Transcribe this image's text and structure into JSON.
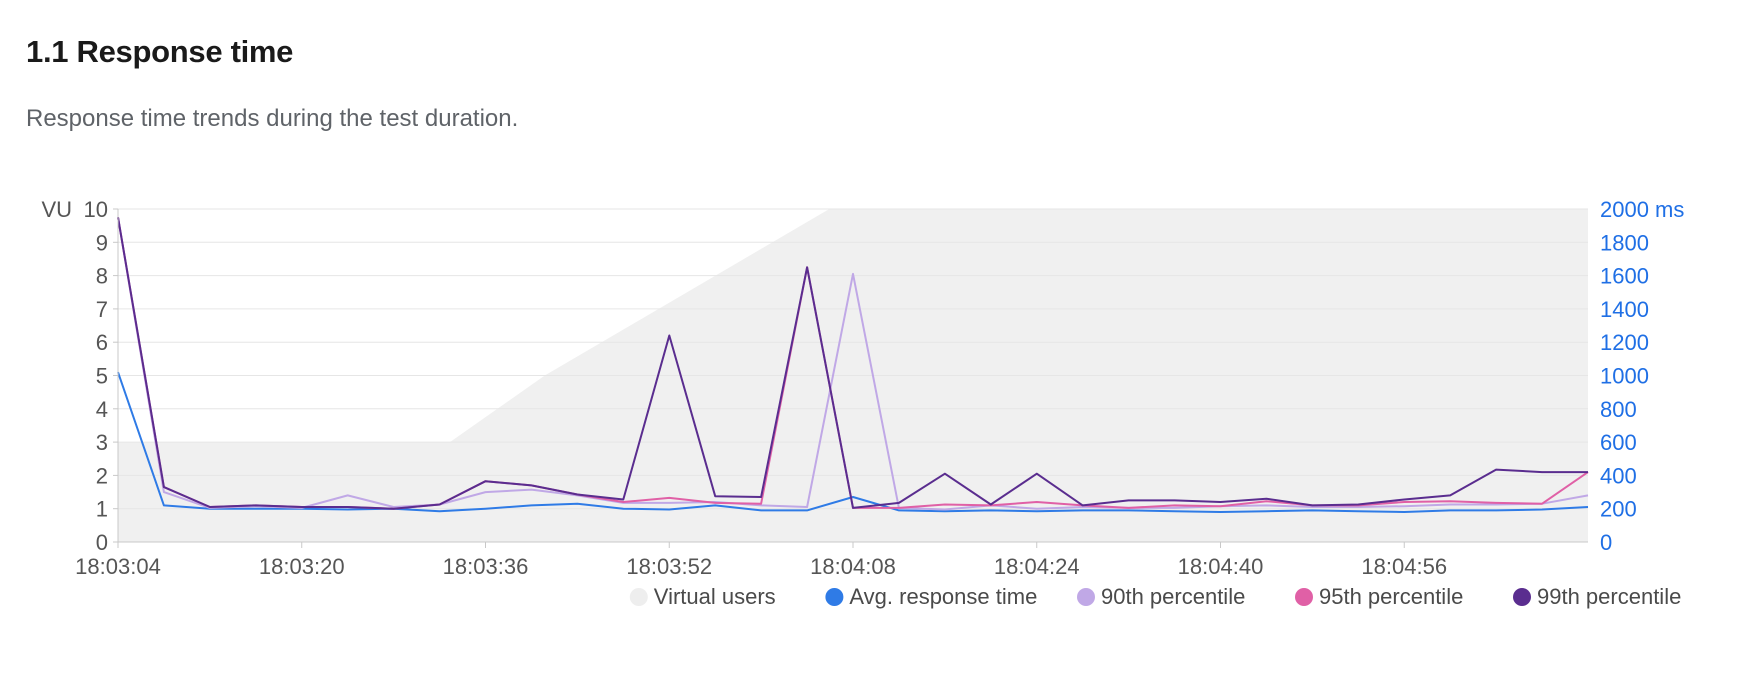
{
  "section": {
    "title": "1.1 Response time",
    "description": "Response time trends during the test duration."
  },
  "chart_data": {
    "type": "line",
    "left_axis": {
      "unit_label": "VU",
      "range": [
        0,
        10
      ],
      "ticks": [
        0,
        1,
        2,
        3,
        4,
        5,
        6,
        7,
        8,
        9,
        10
      ]
    },
    "right_axis": {
      "unit_label": "ms",
      "range": [
        0,
        2000
      ],
      "ticks": [
        0,
        200,
        400,
        600,
        800,
        1000,
        1200,
        1400,
        1600,
        1800,
        2000
      ]
    },
    "x_tick_labels": [
      "18:03:04",
      "18:03:20",
      "18:03:36",
      "18:03:52",
      "18:04:08",
      "18:04:24",
      "18:04:40",
      "18:04:56"
    ],
    "grid": true,
    "legend_position": "bottom-right",
    "colors": {
      "virtual_users": "#f0f0f0",
      "avg": "#2f7be6",
      "p90": "#c0a8e6",
      "p95": "#e060a6",
      "p99": "#5a2d8f",
      "left_axis": "#555555",
      "right_axis": "#1f6fe5"
    },
    "virtual_users": {
      "name": "Virtual users",
      "points": [
        [
          0,
          3
        ],
        [
          28,
          3
        ],
        [
          36,
          5
        ],
        [
          60,
          10
        ],
        [
          124,
          10
        ]
      ]
    },
    "series": [
      {
        "key": "avg",
        "name": "Avg. response time",
        "values": [
          1020,
          220,
          200,
          200,
          200,
          195,
          200,
          185,
          200,
          220,
          230,
          200,
          195,
          220,
          190,
          190,
          270,
          190,
          185,
          190,
          185,
          190,
          190,
          185,
          180,
          185,
          190,
          185,
          180,
          190,
          190,
          195,
          210
        ]
      },
      {
        "key": "p90",
        "name": "90th percentile",
        "values": [
          1950,
          300,
          205,
          215,
          205,
          280,
          210,
          225,
          300,
          315,
          280,
          235,
          235,
          240,
          220,
          210,
          1610,
          205,
          195,
          220,
          200,
          210,
          205,
          205,
          215,
          220,
          210,
          210,
          215,
          225,
          225,
          230,
          280
        ]
      },
      {
        "key": "p95",
        "name": "95th percentile",
        "values": [
          1950,
          330,
          210,
          220,
          210,
          210,
          200,
          225,
          365,
          340,
          285,
          240,
          265,
          235,
          230,
          1650,
          205,
          205,
          225,
          220,
          240,
          220,
          205,
          220,
          215,
          245,
          220,
          220,
          240,
          245,
          235,
          230,
          420
        ]
      },
      {
        "key": "p99",
        "name": "99th percentile",
        "values": [
          1950,
          330,
          210,
          220,
          210,
          210,
          200,
          225,
          365,
          340,
          285,
          255,
          1240,
          275,
          270,
          1650,
          205,
          235,
          410,
          225,
          410,
          220,
          250,
          250,
          240,
          260,
          220,
          225,
          255,
          280,
          435,
          420,
          420
        ]
      }
    ]
  }
}
